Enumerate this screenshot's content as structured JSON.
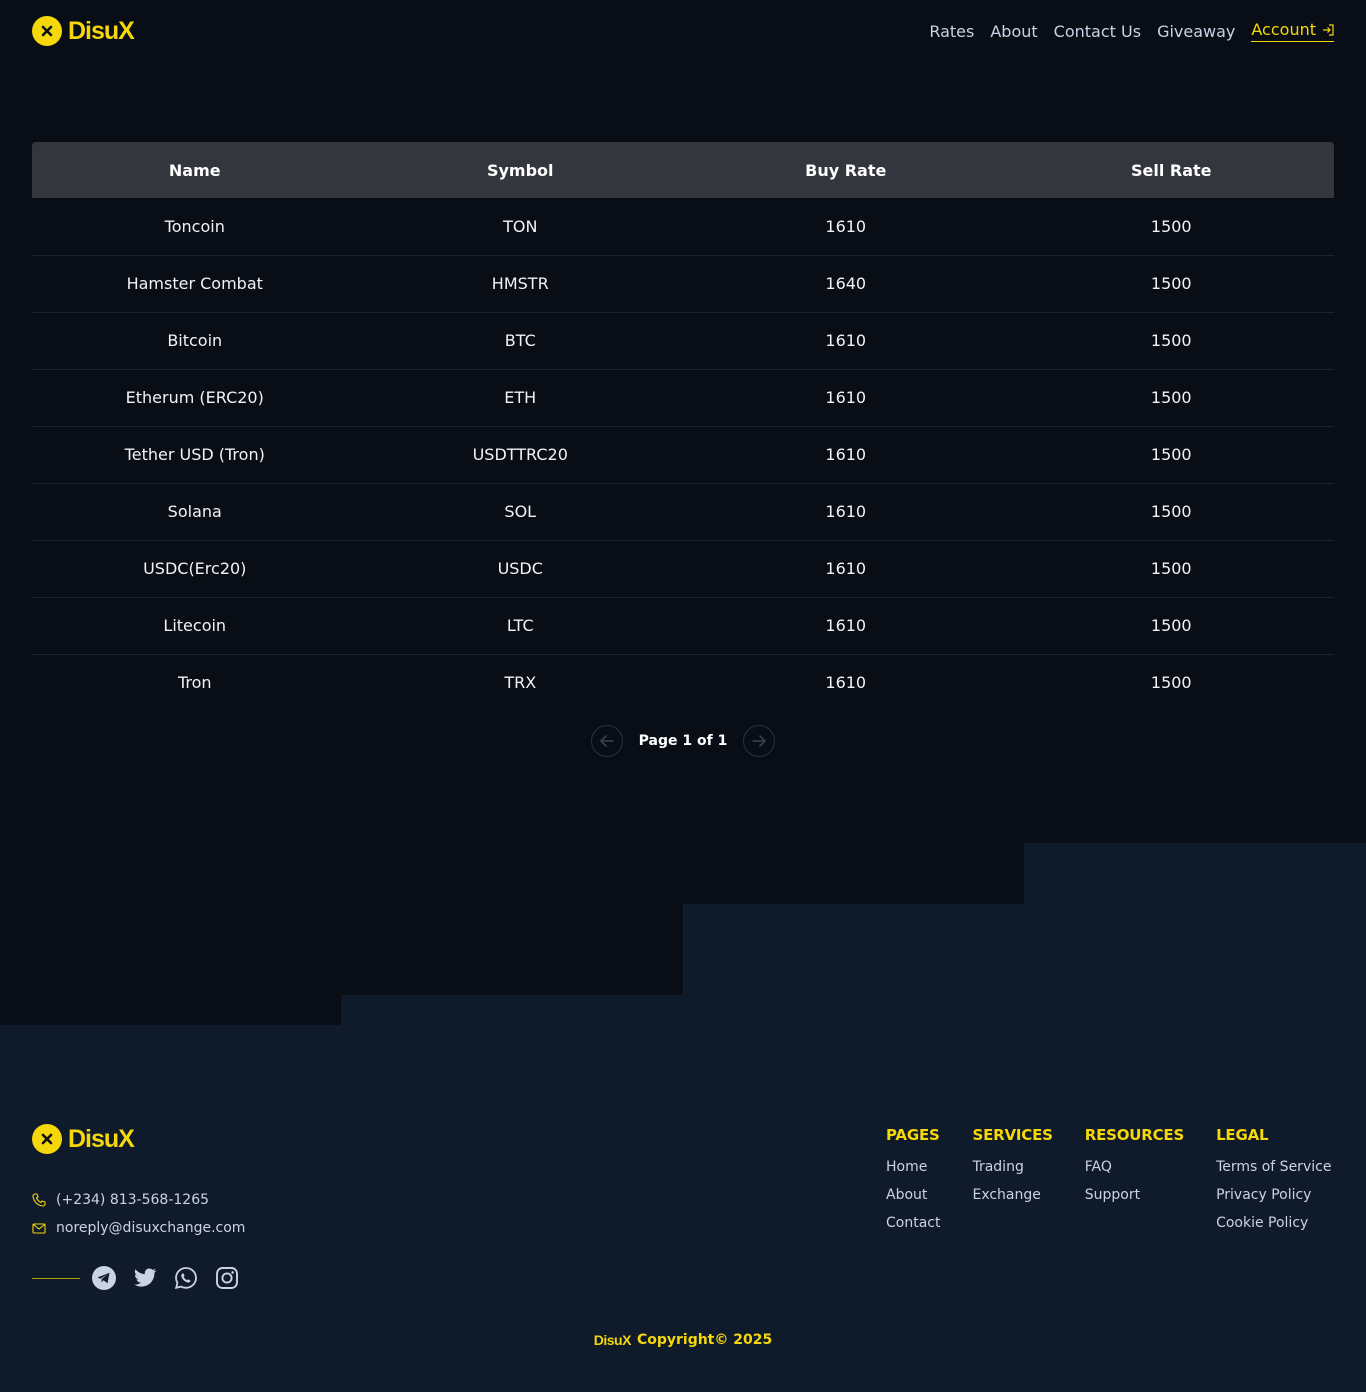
{
  "brand": {
    "name": "DisuX",
    "primary_color": "#f5d70a",
    "bg_color": "#080d16",
    "footer_bg": "#0f1a2b"
  },
  "nav": {
    "items": [
      {
        "label": "Rates"
      },
      {
        "label": "About"
      },
      {
        "label": "Contact Us"
      },
      {
        "label": "Giveaway"
      }
    ],
    "account_label": "Account"
  },
  "table": {
    "headers": [
      "Name",
      "Symbol",
      "Buy Rate",
      "Sell Rate"
    ],
    "rows": [
      [
        "Toncoin",
        "TON",
        "1610",
        "1500"
      ],
      [
        "Hamster Combat",
        "HMSTR",
        "1640",
        "1500"
      ],
      [
        "Bitcoin",
        "BTC",
        "1610",
        "1500"
      ],
      [
        "Etherum (ERC20)",
        "ETH",
        "1610",
        "1500"
      ],
      [
        "Tether USD (Tron)",
        "USDTTRC20",
        "1610",
        "1500"
      ],
      [
        "Solana",
        "SOL",
        "1610",
        "1500"
      ],
      [
        "USDC(Erc20)",
        "USDC",
        "1610",
        "1500"
      ],
      [
        "Litecoin",
        "LTC",
        "1610",
        "1500"
      ],
      [
        "Tron",
        "TRX",
        "1610",
        "1500"
      ]
    ]
  },
  "pagination": {
    "text": "Page 1 of 1"
  },
  "footer": {
    "phone": "(+234) 813-568-1265",
    "email": "noreply@disuxchange.com",
    "socials": [
      "telegram-icon",
      "twitter-icon",
      "whatsapp-icon",
      "instagram-icon"
    ],
    "columns": [
      {
        "title": "PAGES",
        "links": [
          "Home",
          "About",
          "Contact"
        ]
      },
      {
        "title": "SERVICES",
        "links": [
          "Trading",
          "Exchange"
        ]
      },
      {
        "title": "RESOURCES",
        "links": [
          "FAQ",
          "Support"
        ]
      },
      {
        "title": "LEGAL",
        "links": [
          "Terms of Service",
          "Privacy Policy",
          "Cookie Policy"
        ]
      }
    ],
    "copyright": "Copyright© 2025"
  }
}
